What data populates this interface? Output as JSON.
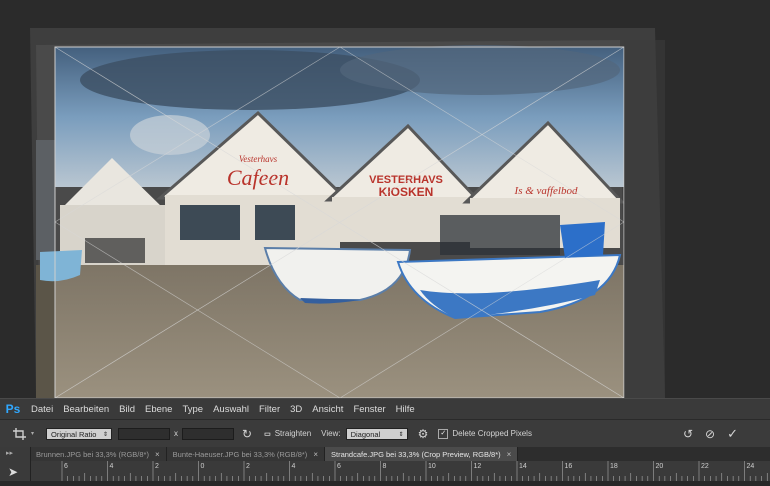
{
  "app": {
    "logo": "Ps"
  },
  "menu": [
    "Datei",
    "Bearbeiten",
    "Bild",
    "Ebene",
    "Type",
    "Auswahl",
    "Filter",
    "3D",
    "Ansicht",
    "Fenster",
    "Hilfe"
  ],
  "options": {
    "tool_icon": "crop-icon",
    "ratio": "Original Ratio",
    "times_sign": "x",
    "straighten_label": "Straighten",
    "view_label": "View:",
    "view_value": "Diagonal",
    "delete_cropped_label": "Delete Cropped Pixels",
    "delete_cropped_checked": true,
    "checkmark": "✓"
  },
  "tabs": [
    {
      "label": "Brunnen.JPG bei 33,3% (RGB/8*)",
      "close": "×",
      "active": false
    },
    {
      "label": "Bunte-Haeuser.JPG bei 33,3% (RGB/8*)",
      "close": "×",
      "active": false
    },
    {
      "label": "Strandcafe.JPG bei 33,3% (Crop Preview, RGB/8*)",
      "close": "×",
      "active": true
    }
  ],
  "ruler": {
    "labels": [
      "6",
      "4",
      "2",
      "0",
      "2",
      "4",
      "6",
      "8",
      "10",
      "12",
      "14",
      "16",
      "18",
      "20",
      "22",
      "24"
    ]
  },
  "photo": {
    "sign_cafe": "Cafeen",
    "sign_cafe_top": "Vesterhavs",
    "sign_kiosk_top": "VESTERHAVS",
    "sign_kiosk": "KIOSKEN",
    "sign_ice": "Is & vaffelbod"
  },
  "colors": {
    "accent": "#31a8ff",
    "sky": "#6f93b5",
    "sand": "#8c8272",
    "boat_blue": "#3c78c4"
  }
}
